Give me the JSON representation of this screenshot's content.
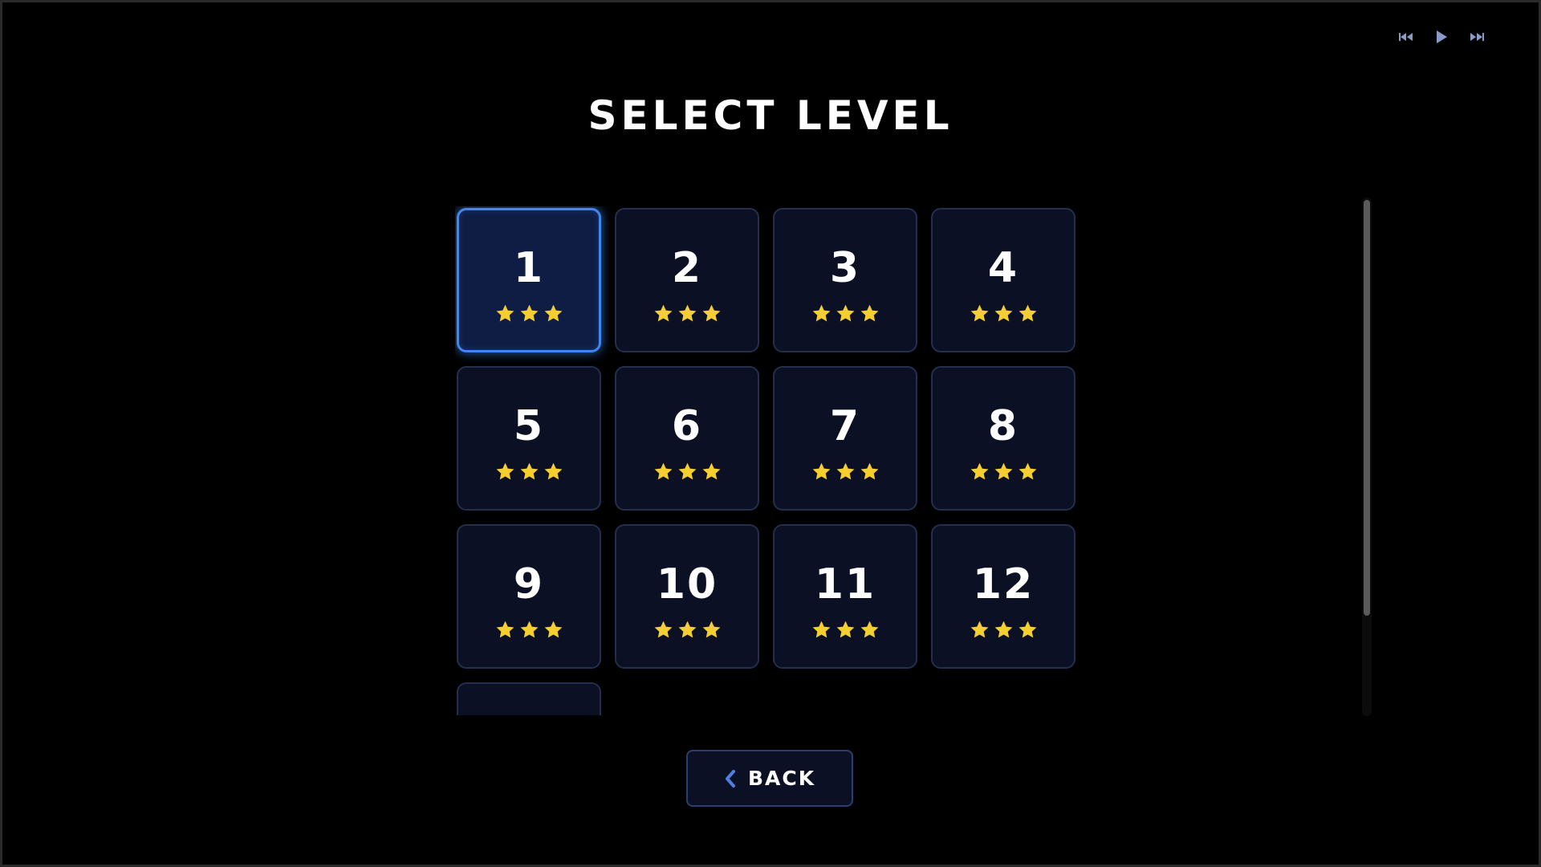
{
  "screen": {
    "title": "SELECT LEVEL"
  },
  "media_controls": [
    {
      "name": "previous-track-button",
      "icon": "skip-previous-icon"
    },
    {
      "name": "play-button",
      "icon": "play-icon"
    },
    {
      "name": "next-track-button",
      "icon": "skip-next-icon"
    }
  ],
  "levels": [
    {
      "number": "1",
      "stars": 3,
      "selected": true
    },
    {
      "number": "2",
      "stars": 3,
      "selected": false
    },
    {
      "number": "3",
      "stars": 3,
      "selected": false
    },
    {
      "number": "4",
      "stars": 3,
      "selected": false
    },
    {
      "number": "5",
      "stars": 3,
      "selected": false
    },
    {
      "number": "6",
      "stars": 3,
      "selected": false
    },
    {
      "number": "7",
      "stars": 3,
      "selected": false
    },
    {
      "number": "8",
      "stars": 3,
      "selected": false
    },
    {
      "number": "9",
      "stars": 3,
      "selected": false
    },
    {
      "number": "10",
      "stars": 3,
      "selected": false
    },
    {
      "number": "11",
      "stars": 3,
      "selected": false
    },
    {
      "number": "12",
      "stars": 3,
      "selected": false
    },
    {
      "number": "",
      "stars": 0,
      "selected": false
    }
  ],
  "scroll": {
    "visible_fraction": 0.81,
    "position_fraction": 0.0
  },
  "back_button": {
    "label": "BACK",
    "icon": "chevron-left-icon"
  },
  "colors": {
    "background": "#000000",
    "tile_background": "#0b1024",
    "tile_border": "#232f4d",
    "selected_border": "#3f86f0",
    "star": "#f5cf2f",
    "accent": "#4f7fe0",
    "media_icon": "#8a9bc8"
  }
}
